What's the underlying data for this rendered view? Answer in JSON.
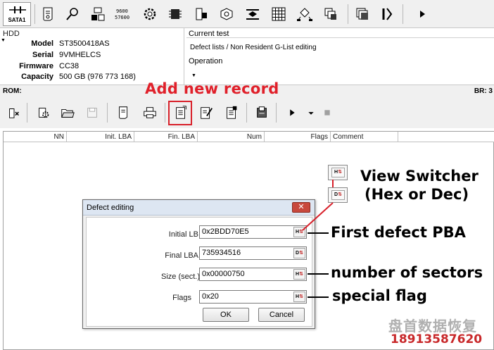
{
  "toolbar": {
    "interface_label": "SATA1",
    "icons": [
      "script-icon",
      "search-icon",
      "device-icon",
      "counter-icon",
      "gear-icon",
      "chip-icon",
      "board-icon",
      "drive-icon",
      "layers-icon",
      "grid-icon",
      "network-icon",
      "windows-icon",
      "tools-icon",
      "play-icon"
    ],
    "counter_top": "9600",
    "counter_bottom": "57600"
  },
  "hdd": {
    "group_title": "HDD",
    "fields": [
      {
        "key": "Model",
        "value": "ST3500418AS"
      },
      {
        "key": "Serial",
        "value": "9VMHELCS"
      },
      {
        "key": "Firmware",
        "value": "CC38"
      },
      {
        "key": "Capacity",
        "value": "500 GB (976 773 168)"
      }
    ]
  },
  "current_test": {
    "title": "Current test",
    "value": "Defect lists / Non Resident G-List editing",
    "operation_title": "Operation"
  },
  "rom": {
    "left": "ROM:",
    "right": "BR: 3"
  },
  "callout_add": "Add new record",
  "toolbar2": {
    "icons": [
      "clear-icon",
      "settings-icon",
      "open-folder-icon",
      "save-icon",
      "script-icon",
      "print-icon",
      "add-record-icon",
      "edit-record-icon",
      "delete-record-icon",
      "export-icon",
      "play-icon",
      "dropdown-icon",
      "stop-icon"
    ]
  },
  "table": {
    "columns": [
      "NN",
      "Init. LBA",
      "Fin. LBA",
      "Num",
      "Flags",
      "Comment"
    ]
  },
  "dialog": {
    "title": "Defect editing",
    "fields": [
      {
        "label": "Initial LB",
        "value": "0x2BDD70E5",
        "mode": "H"
      },
      {
        "label": "Final LBA",
        "value": "735934516",
        "mode": "D"
      },
      {
        "label": "Size (sect.)",
        "value": "0x00000750",
        "mode": "H"
      },
      {
        "label": "Flags",
        "value": "0x20",
        "mode": "H"
      }
    ],
    "ok_label": "OK",
    "cancel_label": "Cancel"
  },
  "view_switcher": {
    "hex_label": "H",
    "dec_label": "D",
    "title_line1": "View Switcher",
    "title_line2": "(Hex or Dec)"
  },
  "annotations": {
    "first_defect": "First defect PBA",
    "num_sectors": "number of sectors",
    "special_flag": "special flag"
  },
  "watermark": {
    "text_cn": "盘首数据恢复",
    "phone": "18913587620"
  }
}
